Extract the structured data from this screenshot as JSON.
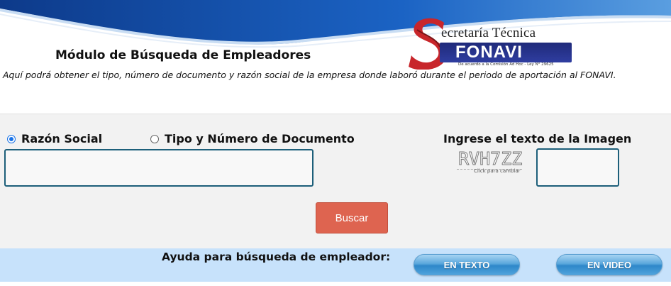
{
  "header": {
    "page_title": "Módulo de Búsqueda de Empleadores",
    "subtitle": "Aquí podrá obtener el tipo, número de documento y razón social de la empresa donde laboró durante el periodo de aportación al FONAVI."
  },
  "logo": {
    "line1": "ecretaría Técnica",
    "line2": "FONAVI",
    "line3": "De acuerdo a la Comisión Ad Hoc - Ley N° 29625",
    "colors": {
      "red": "#c8262b",
      "navy": "#1f2a7a"
    }
  },
  "form": {
    "radio_razon_social": "Razón Social",
    "radio_tipo_numero": "Tipo y Número de Documento",
    "selected": "Razón Social",
    "search_value": "",
    "captcha_label": "Ingrese el texto de la Imagen",
    "captcha_code": "RVH7ZZ",
    "captcha_hint": "Click para cambiar",
    "captcha_value": "",
    "search_button": "Buscar"
  },
  "help": {
    "label": "Ayuda para búsqueda de empleador:",
    "btn_text": "EN TEXTO",
    "btn_video": "EN VIDEO"
  },
  "colors": {
    "panel_bg": "#f2f2f2",
    "help_bg": "#c7e2fb",
    "button_red": "#de6450",
    "input_border": "#1d5f7a",
    "radio_blue": "#1a73e8"
  }
}
